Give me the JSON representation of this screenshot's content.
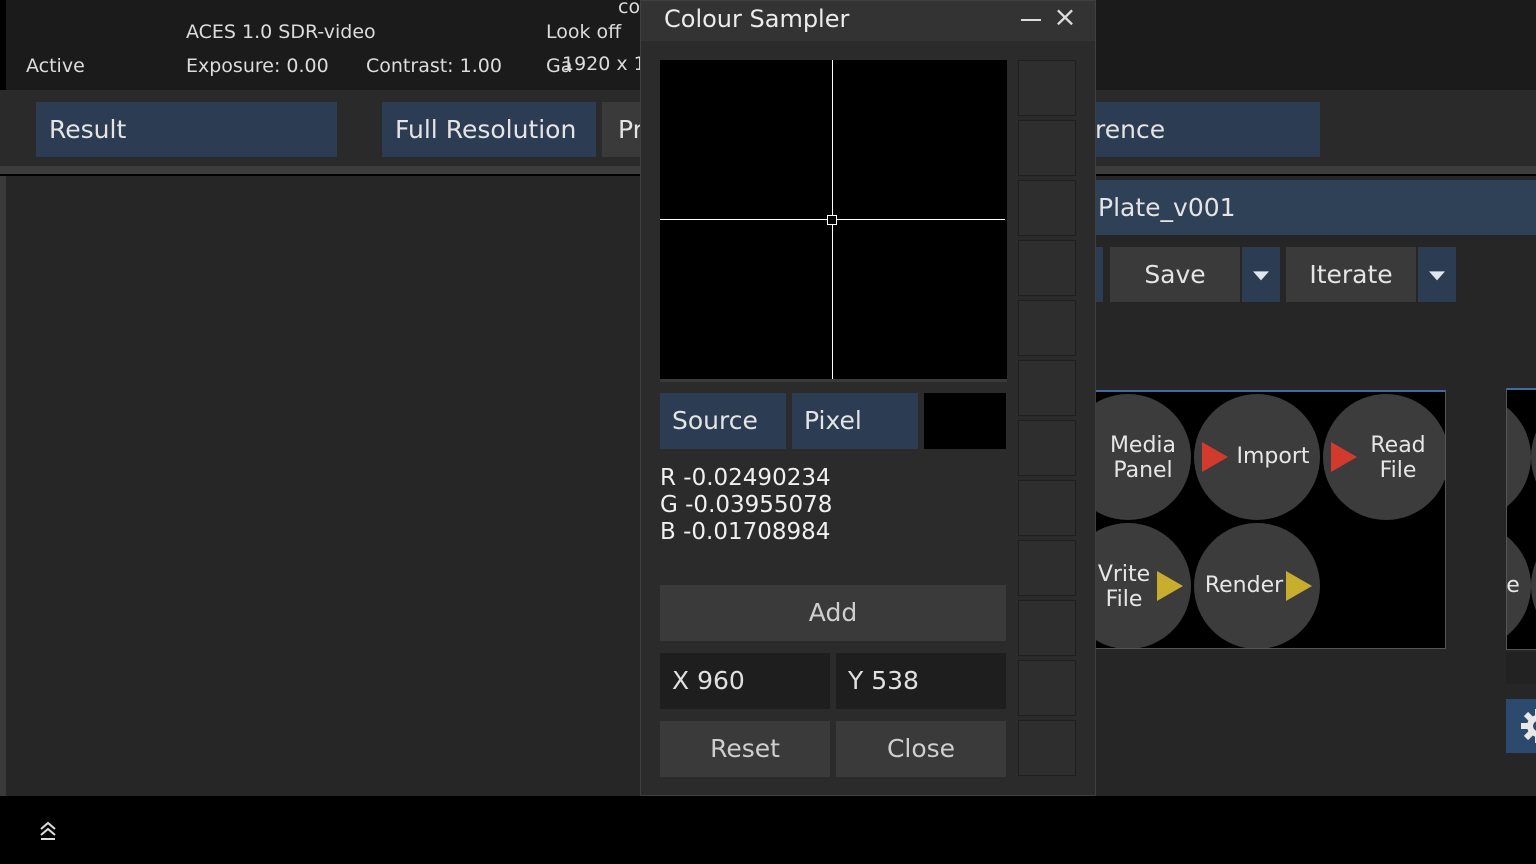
{
  "topbar": {
    "status": "Active",
    "view_transform": "ACES 1.0 SDR-video",
    "exposure": "Exposure: 0.00",
    "contrast": "Contrast: 1.00",
    "look": "Look off",
    "gamma_partial": "Ga",
    "resolution_partial": "1920 x 1",
    "overflow_partial": "co"
  },
  "toolbar": {
    "result": "Result",
    "full_resolution": "Full Resolution",
    "partial_pr": "Pr",
    "partial_reference": "rence"
  },
  "right_panel": {
    "shot_name": "Plate_v001",
    "save": "Save",
    "iterate": "Iterate",
    "buttons": [
      {
        "label": "Media\nPanel",
        "l1": "Media",
        "l2": "Panel"
      },
      {
        "label": "Import"
      },
      {
        "l1": "Read",
        "l2": "File"
      },
      {
        "l1": "Vrite",
        "l2": "File"
      },
      {
        "label": "Render"
      }
    ],
    "panel2_partial": "e",
    "colors": {
      "red_arrow": "#d23a2e",
      "yellow_arrow": "#c9ad2f"
    }
  },
  "dialog": {
    "title": "Colour Sampler",
    "source": "Source",
    "pixel": "Pixel",
    "r": "R -0.02490234",
    "g": "G -0.03955078",
    "b": "B -0.01708984",
    "add": "Add",
    "x": "X 960",
    "y": "Y 538",
    "reset": "Reset",
    "close": "Close",
    "sampled_color": "#000000"
  }
}
